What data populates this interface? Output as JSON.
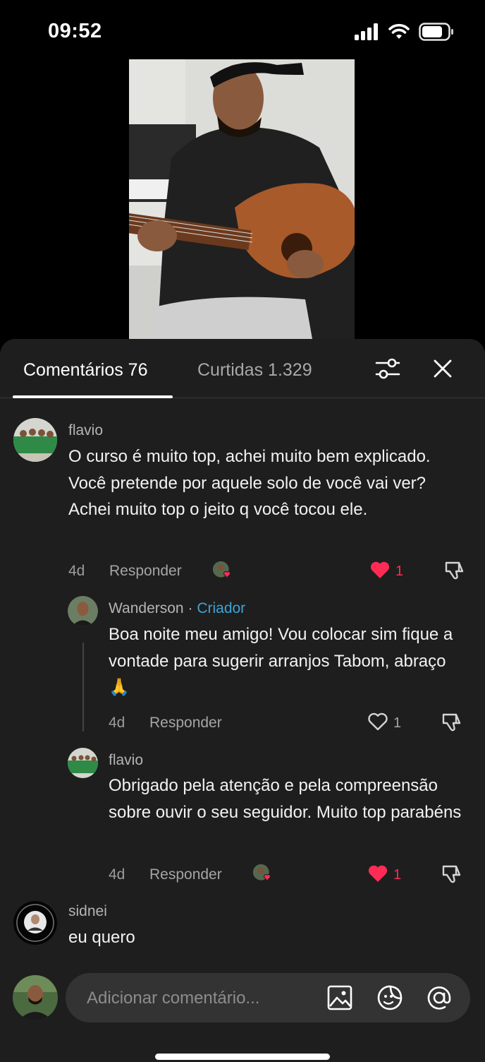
{
  "status_bar": {
    "time": "09:52",
    "battery_fraction": 0.8
  },
  "tabs": {
    "comments_label": "Comentários 76",
    "likes_label": "Curtidas 1.329"
  },
  "comments": [
    {
      "username": "flavio",
      "text": "O curso é muito top, achei muito bem explicado. Você pretende por aquele solo de você vai ver? Achei muito top o jeito q você tocou ele.",
      "age": "4d",
      "reply_label": "Responder",
      "likes": "1",
      "liked": true
    },
    {
      "username": "Wanderson",
      "separator": "·",
      "badge": "Criador",
      "text": "Boa noite meu amigo! Vou colocar sim fique a vontade para sugerir arranjos Tabom, abraço 🙏",
      "age": "4d",
      "reply_label": "Responder",
      "likes": "1",
      "liked": false
    },
    {
      "username": "flavio",
      "text": "Obrigado pela atenção e pela compreensão sobre ouvir o seu seguidor. Muito top parabéns",
      "age": "4d",
      "reply_label": "Responder",
      "likes": "1",
      "liked": true
    },
    {
      "username": "sidnei",
      "text": "eu quero"
    }
  ],
  "composer": {
    "placeholder": "Adicionar comentário..."
  },
  "icons": {
    "status": [
      "signal-icon",
      "wifi-icon",
      "battery-icon"
    ],
    "tabs": [
      "filter-icon",
      "close-icon"
    ],
    "composer": [
      "image-icon",
      "sticker-icon",
      "mention-icon"
    ],
    "actions": [
      "heart-icon",
      "dislike-icon"
    ]
  },
  "colors": {
    "like_red": "#fe2c55",
    "creator_blue": "#3ea3d6",
    "sheet_bg": "#1e1e1e"
  }
}
